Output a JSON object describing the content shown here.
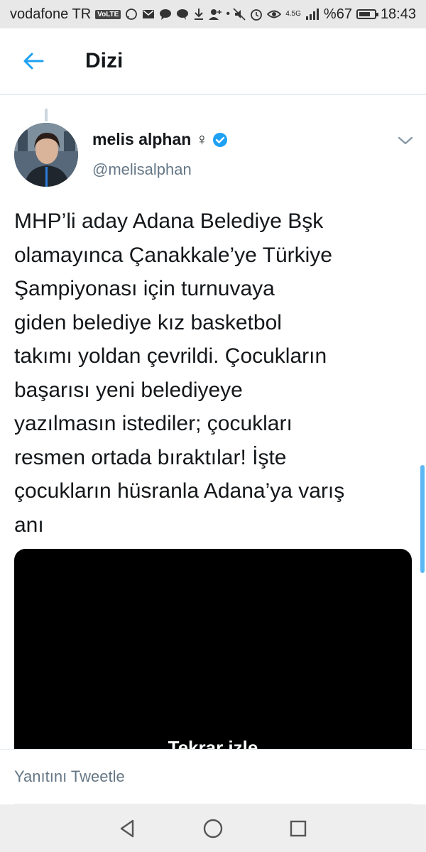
{
  "status_bar": {
    "carrier": "vodafone TR",
    "volte": "VoLTE",
    "network": "4.5G",
    "battery": "%67",
    "time": "18:43"
  },
  "header": {
    "title": "Dizi"
  },
  "tweet": {
    "name": "melis alphan ♀",
    "handle": "@melisalphan",
    "text": "MHP’li aday Adana Belediye Bşk\nolamayınca Çanakkale’ye Türkiye\nŞampiyonası için turnuvaya\ngiden belediye kız basketbol\ntakımı yoldan çevrildi. Çocukların\nbaşarısı yeni belediyeye\nyazılmasın istediler; çocukları\nresmen ortada bıraktılar! İşte\nçocukların hüsranla Adana’ya varış\nanı",
    "video_label": "Tekrar izle"
  },
  "reply": {
    "placeholder": "Yanıtını Tweetle"
  },
  "colors": {
    "accent": "#1da1f2",
    "text": "#14171a",
    "secondary": "#657786"
  },
  "icons": {
    "back": "arrow-left-icon",
    "verified": "verified-badge-icon",
    "more": "chevron-down-icon",
    "nav_back": "triangle-back-icon",
    "nav_home": "circle-home-icon",
    "nav_recents": "square-recents-icon"
  }
}
